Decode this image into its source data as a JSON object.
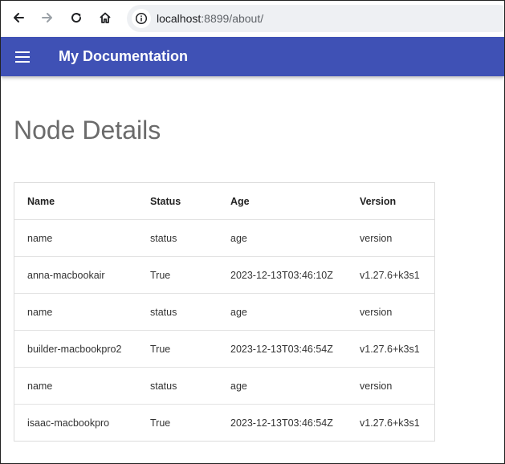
{
  "browser": {
    "url_host": "localhost",
    "url_path": ":8899/about/"
  },
  "header": {
    "site_title": "My Documentation"
  },
  "main": {
    "page_title": "Node Details",
    "table": {
      "columns": [
        "Name",
        "Status",
        "Age",
        "Version"
      ],
      "rows": [
        [
          "name",
          "status",
          "age",
          "version"
        ],
        [
          "anna-macbookair",
          "True",
          "2023-12-13T03:46:10Z",
          "v1.27.6+k3s1"
        ],
        [
          "name",
          "status",
          "age",
          "version"
        ],
        [
          "builder-macbookpro2",
          "True",
          "2023-12-13T03:46:54Z",
          "v1.27.6+k3s1"
        ],
        [
          "name",
          "status",
          "age",
          "version"
        ],
        [
          "isaac-macbookpro",
          "True",
          "2023-12-13T03:46:54Z",
          "v1.27.6+k3s1"
        ]
      ]
    }
  }
}
